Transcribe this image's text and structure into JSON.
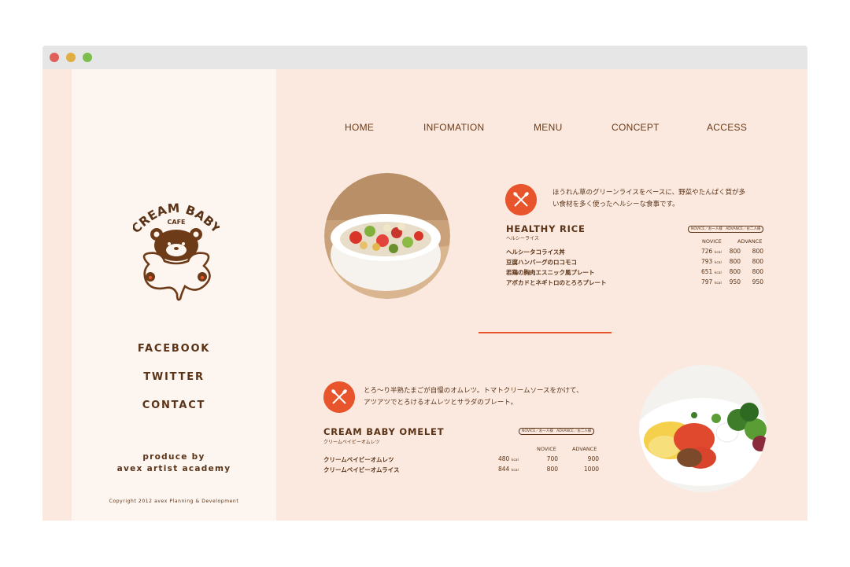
{
  "colors": {
    "accent": "#e8542b",
    "text": "#5a3317",
    "background": "#fbe9df",
    "sidebar": "#fdf5f0"
  },
  "logo": {
    "line1": "CREAM BABY",
    "line2": "CAFE"
  },
  "sidebar": {
    "links": [
      {
        "label": "FACEBOOK"
      },
      {
        "label": "TWITTER"
      },
      {
        "label": "CONTACT"
      }
    ],
    "produce_line1": "produce by",
    "produce_line2": "avex artist academy",
    "copyright": "Copyright 2012 avex Planning & Development"
  },
  "nav": [
    "HOME",
    "INFOMATION",
    "MENU",
    "CONCEPT",
    "ACCESS"
  ],
  "menus": [
    {
      "description_line1": "ほうれん草のグリーンライスをベースに、野菜やたんぱく質が多",
      "description_line2": "い食材を多く使ったヘルシーな食事です。",
      "title": "HEALTHY RICE",
      "subtitle": "ヘルシーライス",
      "tag": "NOVICE／お一人様　ADVANCE／お二人様",
      "col_novice": "NOVICE",
      "col_advance": "ADVANCE",
      "kcal_unit": "kcal",
      "items": [
        {
          "name": "ヘルシータコライス丼",
          "kcal": "726",
          "novice": "800",
          "advance": "800"
        },
        {
          "name": "豆腐ハンバーグのロコモコ",
          "kcal": "793",
          "novice": "800",
          "advance": "800"
        },
        {
          "name": "若鶏の胸肉エスニック風プレート",
          "kcal": "651",
          "novice": "800",
          "advance": "800"
        },
        {
          "name": "アボカドとネギトロのとろろプレート",
          "kcal": "797",
          "novice": "950",
          "advance": "950"
        }
      ]
    },
    {
      "description_line1": "とろ～り半熟たまごが自慢のオムレツ。トマトクリームソースをかけて、",
      "description_line2": "アツアツでとろけるオムレツとサラダのプレート。",
      "title": "CREAM BABY OMELET",
      "subtitle": "クリームベイビーオムレツ",
      "tag": "NOVICE／お一人様　ADVANCE／お二人様",
      "col_novice": "NOVICE",
      "col_advance": "ADVANCE",
      "kcal_unit": "kcal",
      "items": [
        {
          "name": "クリームベイビーオムレツ",
          "kcal": "480",
          "novice": "700",
          "advance": "900"
        },
        {
          "name": "クリームベイビーオムライス",
          "kcal": "844",
          "novice": "800",
          "advance": "1000"
        }
      ]
    }
  ]
}
